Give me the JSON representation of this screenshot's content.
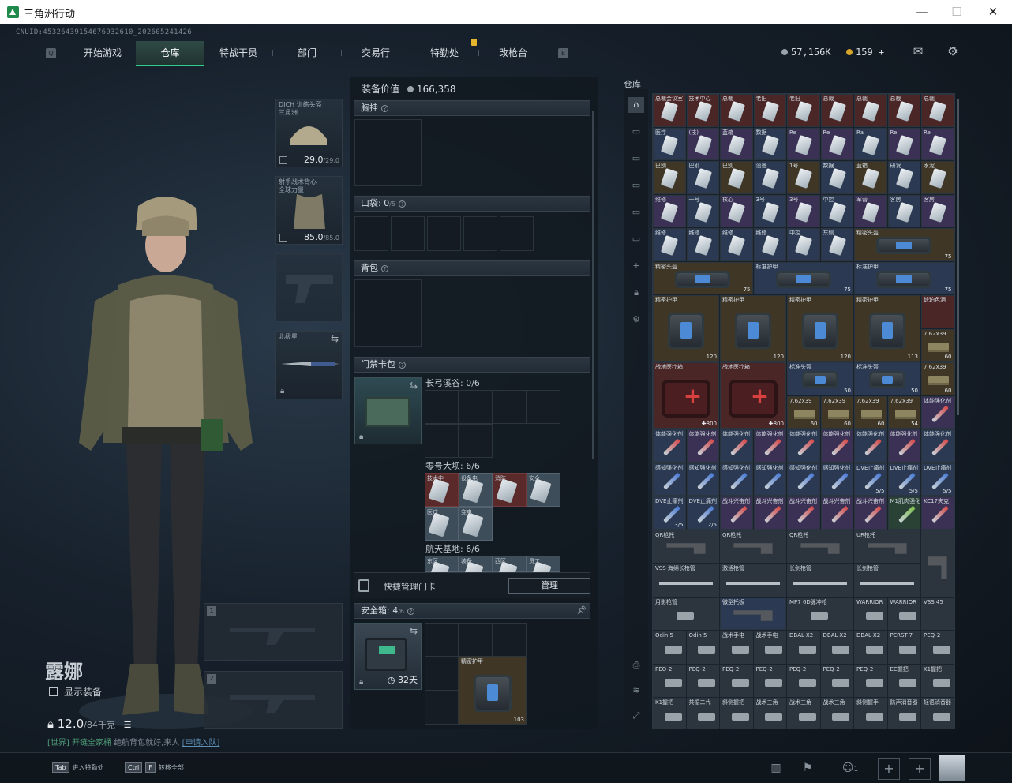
{
  "window": {
    "title": "三角洲行动",
    "min": "—",
    "max": "☐",
    "close": "✕"
  },
  "uid": "CNUID:45326439154676932610_202605241426",
  "nav": {
    "tabs": [
      "开始游戏",
      "仓库",
      "特战干员",
      "部门",
      "交易行",
      "特勤处",
      "改枪台"
    ],
    "active": "仓库"
  },
  "currency": {
    "coins": "57,156K",
    "tickets": "159",
    "plus": "+"
  },
  "character": {
    "name": "露娜",
    "show_equipment": "显示装备",
    "weight": "12.0",
    "weight_max": "/84千克",
    "chat_channel": "[世界]",
    "chat_user": "开链全家桶",
    "chat_msg": "绝航背包就好,来人",
    "chat_link": "[申请入队]"
  },
  "slots": {
    "helmet": {
      "label": "DICH 训练头盔\n三角洲",
      "value": "29.0",
      "max": "/29.0"
    },
    "armor": {
      "label": "射手战术背心\n全球力量",
      "value": "85.0",
      "max": "/85.0"
    },
    "melee": {
      "label": "北极星"
    },
    "weapon1": "1",
    "weapon2": "2"
  },
  "loadout": {
    "equip_value_label": "装备价值",
    "equip_value": "166,358",
    "chest": "胸挂",
    "pocket": "口袋: 0",
    "pocket_max": "/5",
    "backpack": "背包",
    "keycard_pack": "门禁卡包",
    "card_group1": "长弓溪谷: 0/6",
    "card_group2": "零号大坝: 6/6",
    "card_group3": "航天基地: 6/6",
    "quick_label": "快捷管理门卡",
    "quick_btn": "管理",
    "safe_box": "安全箱: 4",
    "safe_box_max": "/6",
    "safe_box_days": "32天",
    "safe_item_name": "精密护甲",
    "safe_item_count": "103",
    "group2_cards": [
      "技术中",
      "设备电",
      "消防",
      "安全"
    ],
    "group2b_cards": [
      "医疗",
      "变电"
    ],
    "group3_cards": [
      "东区",
      "装备",
      "西区",
      "员工"
    ]
  },
  "warehouse": {
    "title": "仓库",
    "row1": [
      "总裁会议室",
      "技术中心",
      "总裁",
      "老旧",
      "老旧",
      "总裁",
      "总裁",
      "总裁",
      "总裁"
    ],
    "row2": [
      "医疗",
      "(技)",
      "蓝箱",
      "数据",
      "Re",
      "Re",
      "Ra",
      "Re",
      "Re"
    ],
    "row3": [
      "巴别",
      "巴别",
      "巴别",
      "设备",
      "1号",
      "数据",
      "蓝箱",
      "研发",
      "水泥"
    ],
    "row4": [
      "维修",
      "一号",
      "核心",
      "3号",
      "3号",
      "中控",
      "军营",
      "客房",
      "客房"
    ],
    "row5": [
      "维修",
      "维修",
      "维修",
      "维修",
      "中控",
      "东侧"
    ],
    "row5_bag": {
      "name": "精密头盔",
      "count": "75"
    },
    "row6": [
      {
        "name": "精密头盔",
        "count": "75"
      },
      {
        "name": "标准护甲",
        "count": "75"
      },
      {
        "name": "标准护甲",
        "count": "75"
      }
    ],
    "row7": [
      {
        "name": "精密护甲",
        "count": "120"
      },
      {
        "name": "精密护甲",
        "count": "120"
      },
      {
        "name": "精密护甲",
        "count": "120"
      },
      {
        "name": "精密护甲",
        "count": "113"
      }
    ],
    "row7_side": [
      {
        "name": "琥珀色酒",
        "count": ""
      },
      {
        "name": "7.62x39",
        "count": "60"
      }
    ],
    "row8_med": [
      {
        "name": "战地医疗箱",
        "count": "800"
      },
      {
        "name": "战地医疗箱",
        "count": "800"
      }
    ],
    "row8_bags": [
      {
        "name": "标准头盔",
        "count": "50"
      },
      {
        "name": "标准头盔",
        "count": "50"
      }
    ],
    "row8_ammo": [
      "7.62x39",
      "60"
    ],
    "row9_ammo": [
      {
        "name": "7.62x39",
        "count": "60"
      },
      {
        "name": "7.62x39",
        "count": "60"
      },
      {
        "name": "7.62x39",
        "count": "60"
      },
      {
        "name": "7.62x39",
        "count": "54"
      }
    ],
    "row9_syr": "体能强化剂",
    "syringe_row1": [
      "体能强化剂",
      "体能强化剂",
      "体能强化剂",
      "体能强化剂",
      "体能强化剂",
      "体能强化剂",
      "体能强化剂",
      "体能强化剂",
      "体能强化剂"
    ],
    "syringe_row2": [
      {
        "name": "感知强化剂",
        "ct": ""
      },
      {
        "name": "感知强化剂",
        "ct": ""
      },
      {
        "name": "感知强化剂",
        "ct": ""
      },
      {
        "name": "感知强化剂",
        "ct": ""
      },
      {
        "name": "感知强化剂",
        "ct": ""
      },
      {
        "name": "感知强化剂",
        "ct": ""
      },
      {
        "name": "DVE止痛剂",
        "ct": "5/5"
      },
      {
        "name": "DVE止痛剂",
        "ct": "5/5"
      },
      {
        "name": "DVE止痛剂",
        "ct": "5/5"
      }
    ],
    "syringe_row3": [
      {
        "name": "DVE止痛剂",
        "ct": "3/5"
      },
      {
        "name": "DVE止痛剂",
        "ct": "2/5"
      },
      {
        "name": "战斗兴奋剂",
        "ct": ""
      },
      {
        "name": "战斗兴奋剂",
        "ct": ""
      },
      {
        "name": "战斗兴奋剂",
        "ct": ""
      },
      {
        "name": "战斗兴奋剂",
        "ct": ""
      },
      {
        "name": "战斗兴奋剂",
        "ct": ""
      },
      {
        "name": "M1肌肉强化",
        "ct": ""
      },
      {
        "name": "KC17夹克",
        "ct": ""
      }
    ],
    "stocks": [
      "QR枪托",
      "QR枪托",
      "QR枪托",
      "UR枪托"
    ],
    "guns_row": [
      "VSS\n海绵长枪管",
      "激活枪管",
      "长剑枪管",
      "长剑枪管",
      "VSS 45"
    ],
    "row_misc": [
      "月影枪管",
      "微型托板",
      "MP7\n6D脉冲枪",
      "WARRIOR",
      "WARRIOR"
    ],
    "row_parts1": [
      "Odin 5",
      "Odin 5",
      "战术手电",
      "战术手电",
      "DBAL-X2",
      "DBAL-X2",
      "DBAL-X2",
      "PERST-7",
      "PEQ-2"
    ],
    "row_parts2": [
      "PEQ-2",
      "PEQ-2",
      "PEQ-2",
      "PEQ-2",
      "PEQ-2",
      "PEQ-2",
      "PEQ-2",
      "EC握把",
      "K1握把"
    ],
    "row_parts3": [
      "K1握把",
      "共振二代",
      "斜侧握把",
      "战术三角",
      "战术三角",
      "战术三角",
      "斜侧握手",
      "防声消音器",
      "轻语消音器"
    ]
  },
  "bottom": {
    "key1": "Tab",
    "key1_label": "进入特勤处",
    "key2": "Ctrl",
    "key2b": "F",
    "key2_label": "转移全部",
    "team_count": "1"
  }
}
